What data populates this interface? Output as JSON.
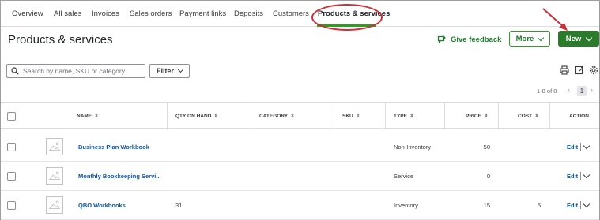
{
  "tabs": [
    "Overview",
    "All sales",
    "Invoices",
    "Sales orders",
    "Payment links",
    "Deposits",
    "Customers",
    "Products & services"
  ],
  "header": {
    "title": "Products & services",
    "feedback_label": "Give feedback",
    "more_label": "More",
    "new_label": "New"
  },
  "toolbar": {
    "search_placeholder": "Search by name, SKU or category",
    "filter_label": "Filter"
  },
  "pager": {
    "range": "1-8 of 8",
    "prev": "‹",
    "page": "1",
    "next": "›"
  },
  "columns": [
    "NAME",
    "QTY ON HAND",
    "CATEGORY",
    "SKU",
    "TYPE",
    "PRICE",
    "COST",
    "ACTION"
  ],
  "rows": [
    {
      "name": "Business Plan Workbook",
      "qty": "",
      "category": "",
      "sku": "",
      "type": "Non-Inventory",
      "price": "50",
      "cost": "",
      "action": "Edit"
    },
    {
      "name": "Monthly Bookkeeping Servi...",
      "qty": "",
      "category": "",
      "sku": "",
      "type": "Service",
      "price": "0",
      "cost": "",
      "action": "Edit"
    },
    {
      "name": "QBO Workbooks",
      "qty": "31",
      "category": "",
      "sku": "",
      "type": "Inventory",
      "price": "15",
      "cost": "5",
      "action": "Edit"
    }
  ],
  "colors": {
    "accent_green": "#2ca01c",
    "button_green": "#2c7a2c",
    "link_blue": "#0d57a6",
    "annotation_red": "#c8313a"
  },
  "icons": [
    "search-icon",
    "chevron-down-icon",
    "printer-icon",
    "export-icon",
    "gear-icon",
    "feedback-icon",
    "image-placeholder-icon",
    "sort-icon"
  ]
}
